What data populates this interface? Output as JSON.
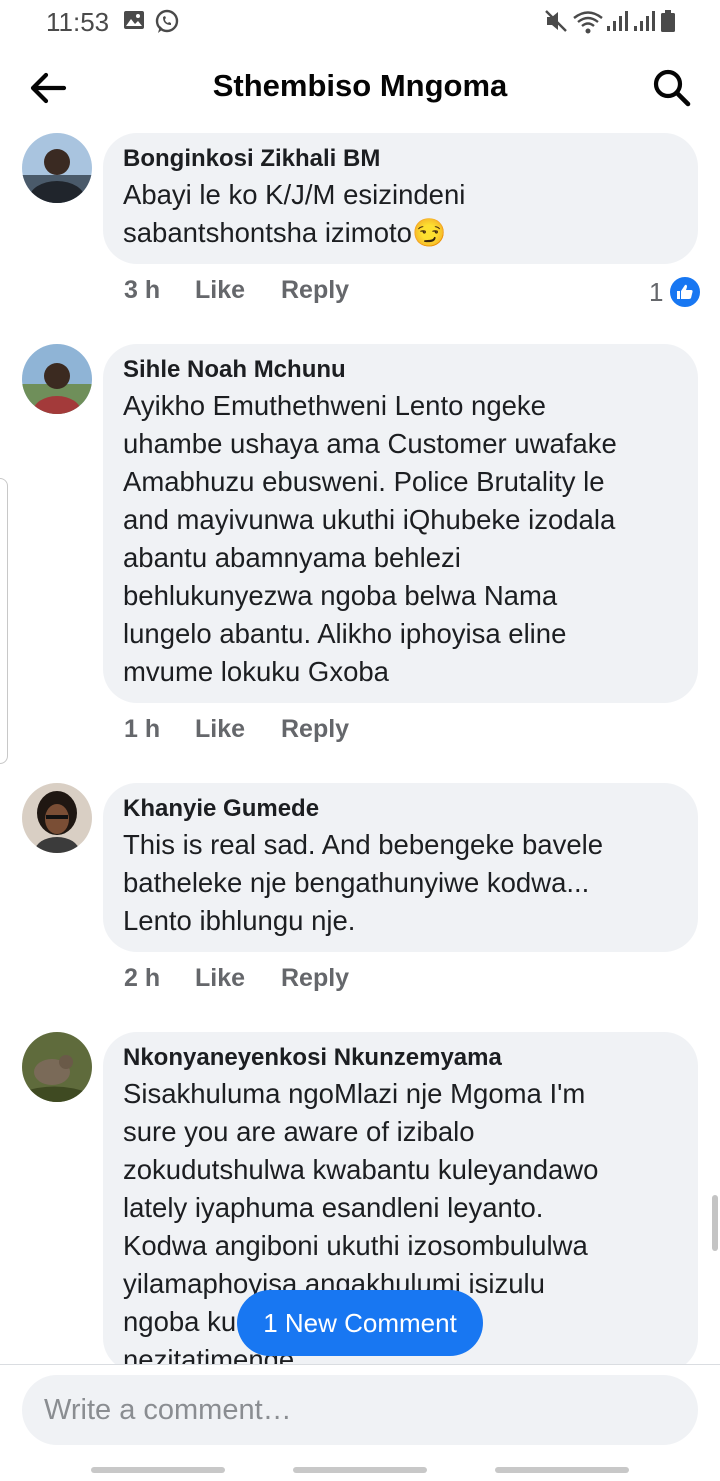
{
  "status_bar": {
    "time": "11:53"
  },
  "header": {
    "title": "Sthembiso Mngoma"
  },
  "comments": [
    {
      "author": "Bonginkosi Zikhali BM",
      "text": "Abayi le ko K/J/M esizindeni\nsabantshontsha izimoto",
      "emoji": "😏",
      "time": "3 h",
      "like": "Like",
      "reply": "Reply",
      "reactions": "1"
    },
    {
      "author": "Sihle Noah Mchunu",
      "text": "Ayikho Emuthethweni Lento ngeke\nuhambe ushaya ama Customer uwafake\nAmabhuzu ebusweni. Police Brutality le\nand mayivunwa ukuthi iQhubeke izodala\nabantu abamnyama behlezi\nbehlukunyezwa ngoba belwa Nama\nlungelo abantu. Alikho iphoyisa eline\nmvume lokuku Gxoba",
      "time": "1 h",
      "like": "Like",
      "reply": "Reply"
    },
    {
      "author": "Khanyie Gumede",
      "text": "This is real sad. And bebengeke bavele\nbatheleke nje bengathunyiwe kodwa...\nLento ibhlungu nje.",
      "time": "2 h",
      "like": "Like",
      "reply": "Reply"
    },
    {
      "author": "Nkonyaneyenkosi Nkunzemyama",
      "text": "Sisakhuluma ngoMlazi nje Mgoma I'm\nsure you are aware of izibalo\nzokudutshulwa kwabantu kuleyandawo\nlately iyaphuma esandleni leyanto.\nKodwa angiboni ukuthi izosombululwa\nyilamaphoyisa angakhulumi isizulu\nngoba ku\nnezitatimende"
    }
  ],
  "new_comment_button": "1 New Comment",
  "compose": {
    "placeholder": "Write a comment…"
  },
  "colors": {
    "accent": "#1877f2",
    "bubble": "#f0f2f5",
    "secondary_text": "#65676b"
  },
  "icons": [
    "back-arrow-icon",
    "search-icon",
    "like-reaction-icon",
    "gallery-icon",
    "whatsapp-icon",
    "mute-icon",
    "wifi-icon",
    "signal-icon",
    "battery-icon"
  ]
}
